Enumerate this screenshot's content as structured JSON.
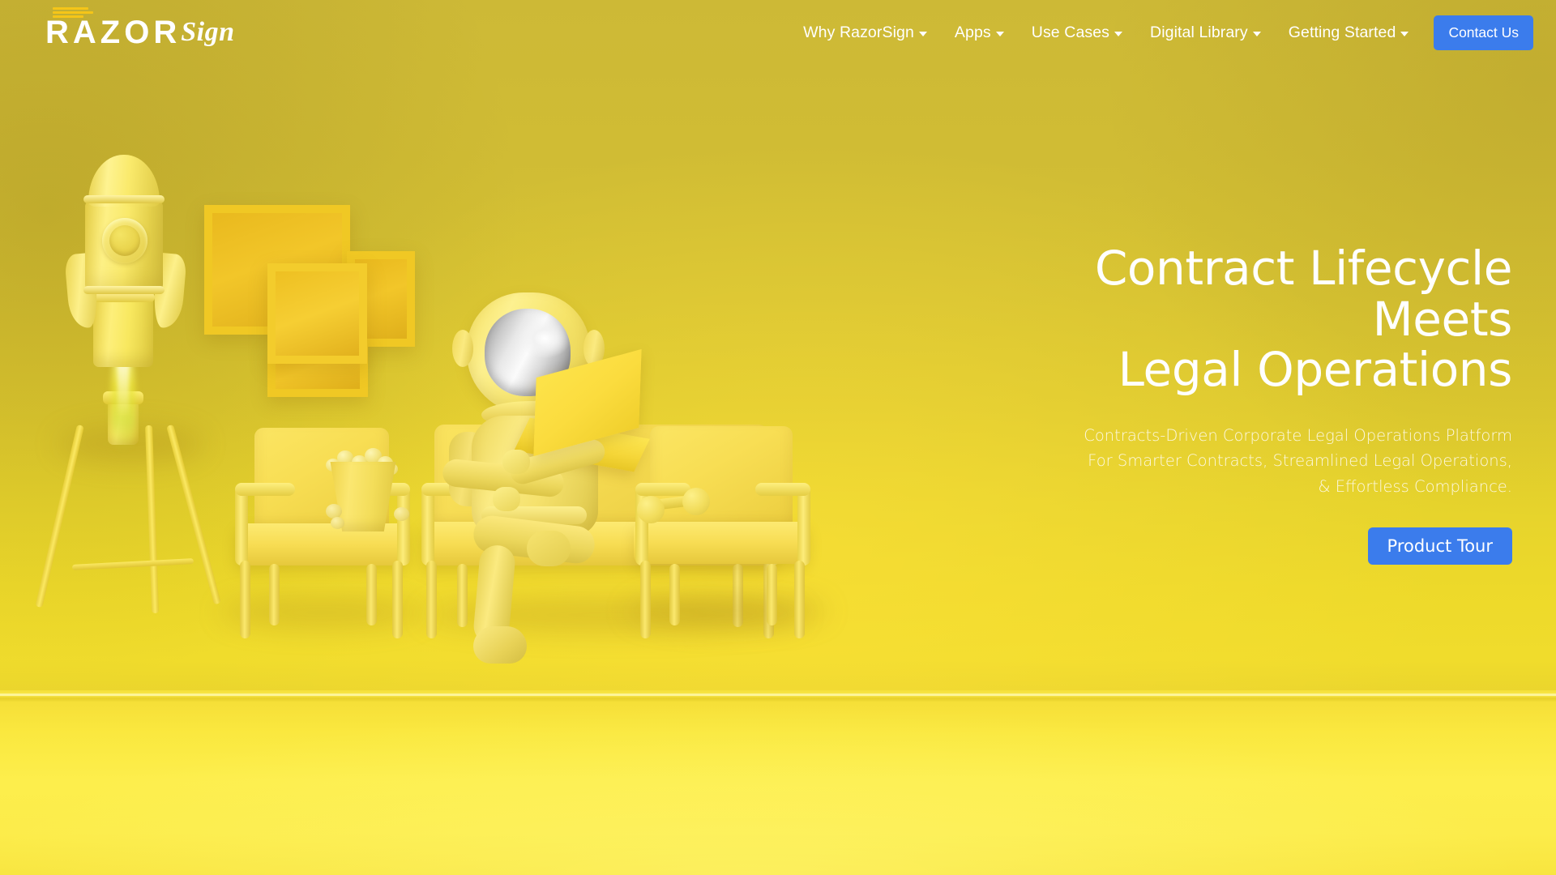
{
  "brand": {
    "logo_word_primary": "RAZOR",
    "logo_word_secondary": "Sign",
    "logo_stripes_icon": "three-stripes-icon",
    "accent_blue": "#3b7cec",
    "wall_yellow": "#cdb936",
    "floor_yellow": "#fbe93f"
  },
  "nav": {
    "items": [
      {
        "label": "Why RazorSign",
        "has_dropdown": true,
        "caret_icon": "chevron-down-icon"
      },
      {
        "label": "Apps",
        "has_dropdown": true,
        "caret_icon": "chevron-down-icon"
      },
      {
        "label": "Use Cases",
        "has_dropdown": true,
        "caret_icon": "chevron-down-icon"
      },
      {
        "label": "Digital Library",
        "has_dropdown": true,
        "caret_icon": "chevron-down-icon"
      },
      {
        "label": "Getting Started",
        "has_dropdown": true,
        "caret_icon": "chevron-down-icon"
      }
    ],
    "cta": {
      "label": "Contact Us"
    }
  },
  "hero": {
    "heading_lines": [
      "Contract Lifecycle",
      "Meets",
      "Legal Operations"
    ],
    "subheading_lines": [
      "Contracts-Driven Corporate Legal Operations Platform",
      "For Smarter Contracts, Streamlined Legal Operations,",
      "& Effortless Compliance."
    ],
    "cta": {
      "label": "Product Tour"
    }
  },
  "illustration": {
    "description": "3D rendered monochrome-yellow room scene",
    "objects": [
      {
        "name": "rocket-on-tripod-stand",
        "detail": "yellow toy rocket with round porthole, fins and glowing exhaust flame"
      },
      {
        "name": "wall-shelves",
        "detail": "three interlocking square box shelves in brighter yellow"
      },
      {
        "name": "armchair-left",
        "detail": "yellow armchair"
      },
      {
        "name": "popcorn-bucket",
        "detail": "yellow bucket filled with popcorn kernels"
      },
      {
        "name": "sofa-center",
        "detail": "yellow two-seat sofa"
      },
      {
        "name": "astronaut-figure",
        "detail": "yellow astronaut with chrome mirrored visor using a yellow laptop"
      },
      {
        "name": "armchair-right",
        "detail": "yellow armchair"
      },
      {
        "name": "dumbbell",
        "detail": "small yellow dumbbell on the floor"
      }
    ]
  }
}
